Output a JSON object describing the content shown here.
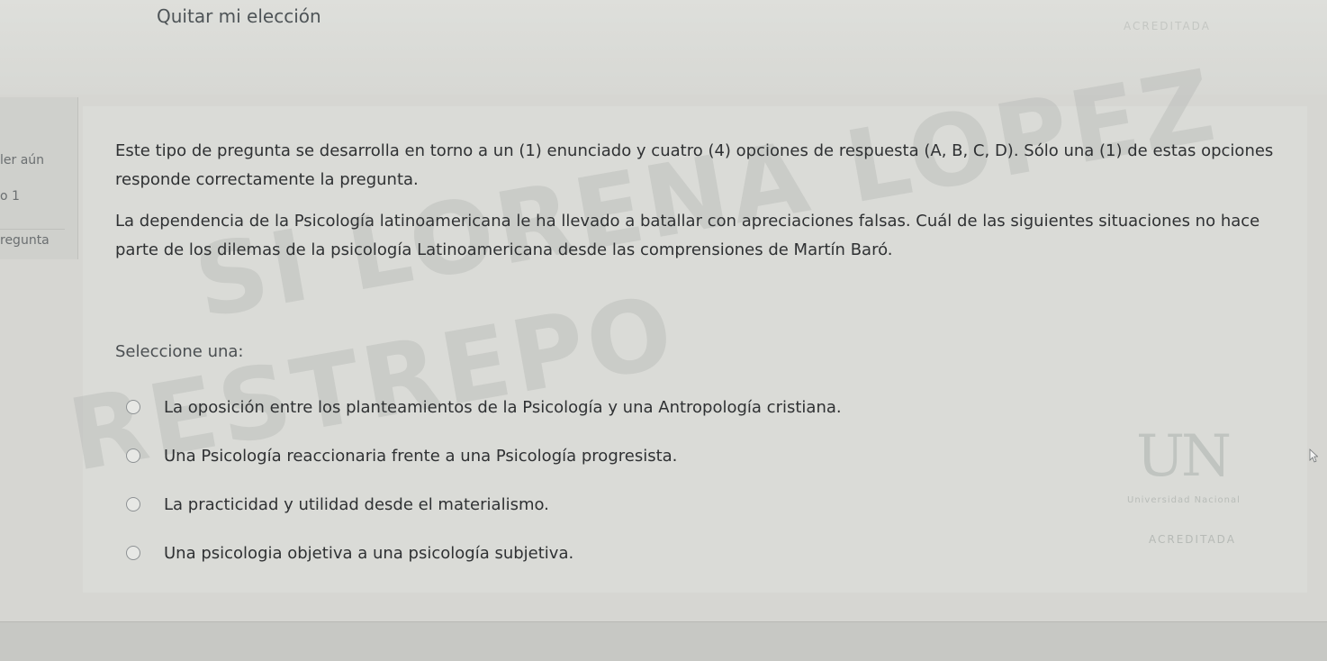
{
  "header": {
    "remove_choice_label": "Quitar mi elección",
    "logo_text": "ACREDITADA"
  },
  "left_panel": {
    "state_text": "ler aún",
    "score_text": "o 1",
    "flag_text": "regunta"
  },
  "question": {
    "instructions": "Este tipo de pregunta se desarrolla en torno a un (1) enunciado y cuatro (4) opciones de respuesta (A, B, C, D). Sólo una (1) de estas opciones responde correctamente la pregunta.",
    "text": "La dependencia de la Psicología latinoamericana le ha llevado a batallar con apreciaciones falsas. Cuál de las siguientes situaciones no hace parte de los dilemas de la psicología Latinoamericana desde las comprensiones de Martín Baró.",
    "select_label": "Seleccione una:",
    "options": [
      {
        "label": "La oposición entre los planteamientos de la Psicología y una Antropología cristiana.",
        "selected": false
      },
      {
        "label": "Una Psicología reaccionaria frente a una Psicología progresista.",
        "selected": false
      },
      {
        "label": "La practicidad y utilidad desde el materialismo.",
        "selected": false
      },
      {
        "label": "Una psicologia objetiva a una psicología subjetiva.",
        "selected": false
      }
    ]
  },
  "watermark": {
    "line1": "SI LORENA LOPEZ",
    "line2": "RESTREPO"
  },
  "university_logo": {
    "mark": "UN",
    "subtitle": "Universidad Nacional",
    "accreditation": "ACREDITADA"
  },
  "colors": {
    "background": "#d6d6d2",
    "text": "#2f3133",
    "muted_text": "#4e5457",
    "radio_border": "#8e9294"
  }
}
